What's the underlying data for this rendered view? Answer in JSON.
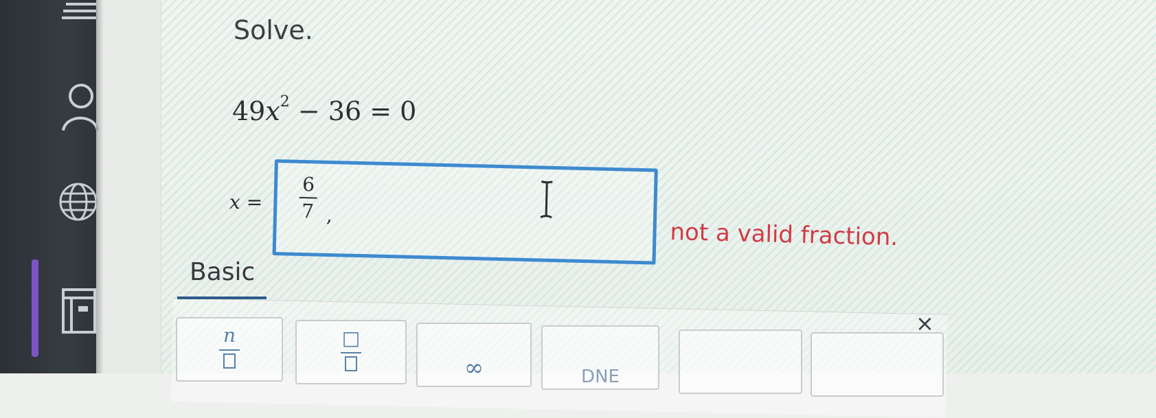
{
  "problem": {
    "instruction": "Solve.",
    "equation": {
      "coefficient": "49",
      "variable": "x",
      "exponent": "2",
      "rest": "− 36 = 0"
    }
  },
  "answer": {
    "label_var": "x",
    "label_eq": "=",
    "fraction_num": "6",
    "fraction_den": "7",
    "separator": ","
  },
  "error": "not a valid fraction.",
  "keypad": {
    "tab_label": "Basic",
    "close_label": "×",
    "keys": [
      {
        "label": "n"
      },
      {
        "label": "□"
      },
      {
        "label": "∞"
      },
      {
        "label": "DNE"
      },
      {
        "label": ""
      },
      {
        "label": ""
      }
    ]
  },
  "icons": [
    "list-icon",
    "user-icon",
    "globe-icon",
    "book-icon"
  ]
}
